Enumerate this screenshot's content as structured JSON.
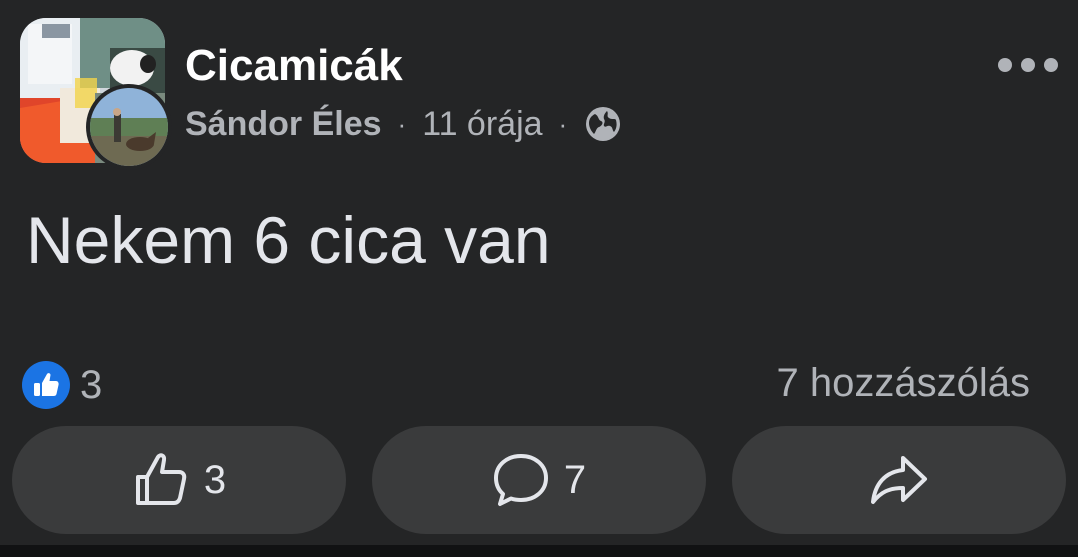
{
  "post": {
    "group_name": "Cicamicák",
    "author": "Sándor Éles",
    "separator": "·",
    "time": "11 órája",
    "text": "Nekem 6 cica van",
    "privacy_icon": "globe-icon"
  },
  "reactions": {
    "icon": "like-icon",
    "count": "3",
    "comments_label": "7 hozzászólás"
  },
  "actions": {
    "like_count": "3",
    "comment_count": "7",
    "share_icon": "share-icon"
  },
  "colors": {
    "background": "#242526",
    "button": "#3a3b3c",
    "like_blue": "#1b74e4",
    "text_primary": "#e4e6eb",
    "text_secondary": "#b0b3b8"
  }
}
